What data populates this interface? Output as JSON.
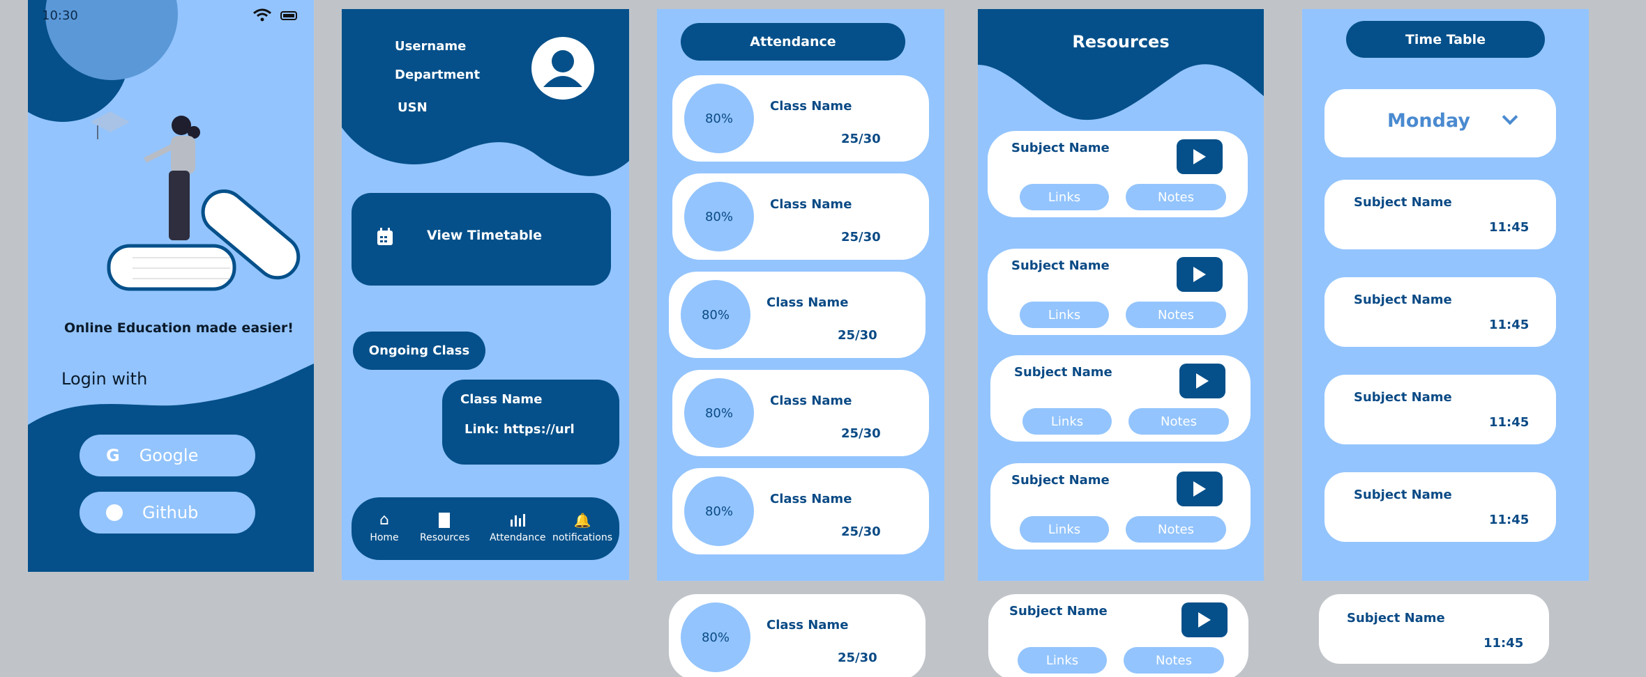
{
  "login": {
    "status_time": "10:30",
    "tagline": "Online Education made easier!",
    "login_with": "Login with",
    "google_label": "Google",
    "github_label": "Github"
  },
  "home": {
    "username": "Username",
    "department": "Department",
    "usn": "USN",
    "view_timetable": "View Timetable",
    "ongoing_class": "Ongoing Class",
    "ongoing_class_name": "Class Name",
    "ongoing_link": "Link: https://url",
    "nav": [
      "Home",
      "Resources",
      "Attendance",
      "notifications"
    ]
  },
  "attendance": {
    "title": "Attendance",
    "items": [
      {
        "percent": "80%",
        "name": "Class Name",
        "count": "25/30"
      },
      {
        "percent": "80%",
        "name": "Class Name",
        "count": "25/30"
      },
      {
        "percent": "80%",
        "name": "Class Name",
        "count": "25/30"
      },
      {
        "percent": "80%",
        "name": "Class Name",
        "count": "25/30"
      },
      {
        "percent": "80%",
        "name": "Class Name",
        "count": "25/30"
      },
      {
        "percent": "80%",
        "name": "Class Name",
        "count": "25/30"
      }
    ]
  },
  "resources": {
    "title": "Resources",
    "items": [
      {
        "subject": "Subject Name",
        "links": "Links",
        "notes": "Notes"
      },
      {
        "subject": "Subject Name",
        "links": "Links",
        "notes": "Notes"
      },
      {
        "subject": "Subject Name",
        "links": "Links",
        "notes": "Notes"
      },
      {
        "subject": "Subject Name",
        "links": "Links",
        "notes": "Notes"
      },
      {
        "subject": "Subject Name",
        "links": "Links",
        "notes": "Notes"
      }
    ]
  },
  "timetable": {
    "title": "Time Table",
    "day": "Monday",
    "items": [
      {
        "subject": "Subject Name",
        "time": "11:45"
      },
      {
        "subject": "Subject Name",
        "time": "11:45"
      },
      {
        "subject": "Subject Name",
        "time": "11:45"
      },
      {
        "subject": "Subject Name",
        "time": "11:45"
      },
      {
        "subject": "Subject Name",
        "time": "11:45"
      }
    ]
  },
  "colors": {
    "dark": "#05508a",
    "light": "#93c4fd",
    "background": "#c0c4c9"
  }
}
